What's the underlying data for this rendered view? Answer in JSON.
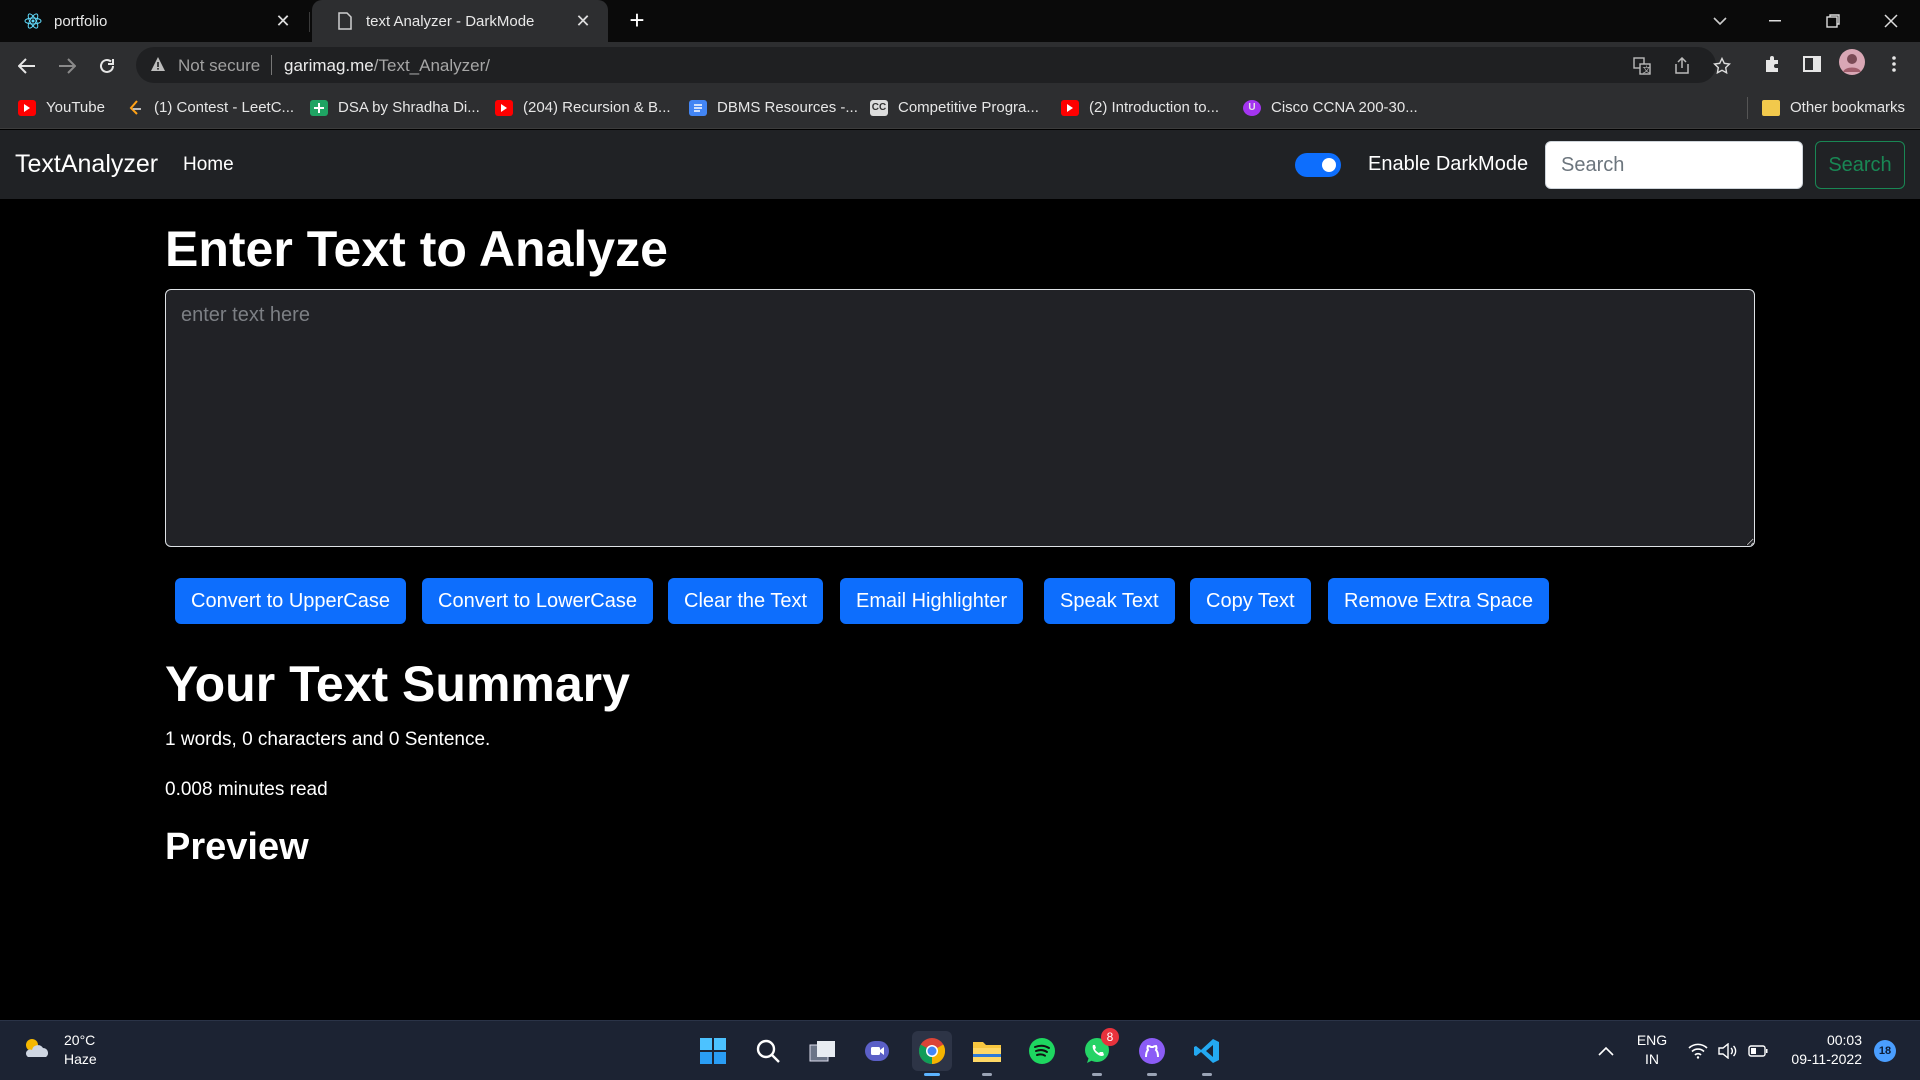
{
  "browser": {
    "tabs": [
      {
        "title": "portfolio",
        "icon": "react-icon"
      },
      {
        "title": "text Analyzer - DarkMode",
        "icon": "page-icon"
      }
    ],
    "address": {
      "security": "Not secure",
      "domain": "garimag.me",
      "path": "/Text_Analyzer/"
    },
    "bookmarks": [
      {
        "label": "YouTube",
        "icon": "youtube-icon"
      },
      {
        "label": "(1) Contest - LeetC...",
        "icon": "leetcode-icon"
      },
      {
        "label": "DSA by Shradha Di...",
        "icon": "sheets-icon"
      },
      {
        "label": "(204) Recursion & B...",
        "icon": "youtube-icon"
      },
      {
        "label": "DBMS Resources -...",
        "icon": "docs-icon"
      },
      {
        "label": "Competitive Progra...",
        "icon": "codechef-icon"
      },
      {
        "label": "(2) Introduction to...",
        "icon": "youtube-icon"
      },
      {
        "label": "Cisco CCNA 200-30...",
        "icon": "udemy-icon"
      }
    ],
    "other_bookmarks": "Other bookmarks"
  },
  "app": {
    "brand": "TextAnalyzer",
    "nav_home": "Home",
    "dark_mode_label": "Enable DarkMode",
    "dark_mode_on": true,
    "search_placeholder": "Search",
    "search_button": "Search"
  },
  "main": {
    "heading": "Enter Text to Analyze",
    "textarea_placeholder": "enter text here",
    "textarea_value": "",
    "buttons": [
      "Convert to UpperCase",
      "Convert to LowerCase",
      "Clear the Text",
      "Email Highlighter",
      "Speak Text",
      "Copy Text",
      "Remove Extra Space"
    ],
    "summary_heading": "Your Text Summary",
    "summary_counts": "1 words, 0 characters and 0 Sentence.",
    "read_time": "0.008 minutes read",
    "preview_heading": "Preview"
  },
  "taskbar": {
    "weather_temp": "20°C",
    "weather_desc": "Haze",
    "whatsapp_badge": "8",
    "lang_top": "ENG",
    "lang_bottom": "IN",
    "time": "00:03",
    "date": "09-11-2022",
    "notification_count": "18"
  },
  "colors": {
    "primary": "#0d6efd",
    "success": "#198754",
    "navbar_bg": "#202225",
    "page_bg": "#000000",
    "textarea_bg": "#212226"
  }
}
